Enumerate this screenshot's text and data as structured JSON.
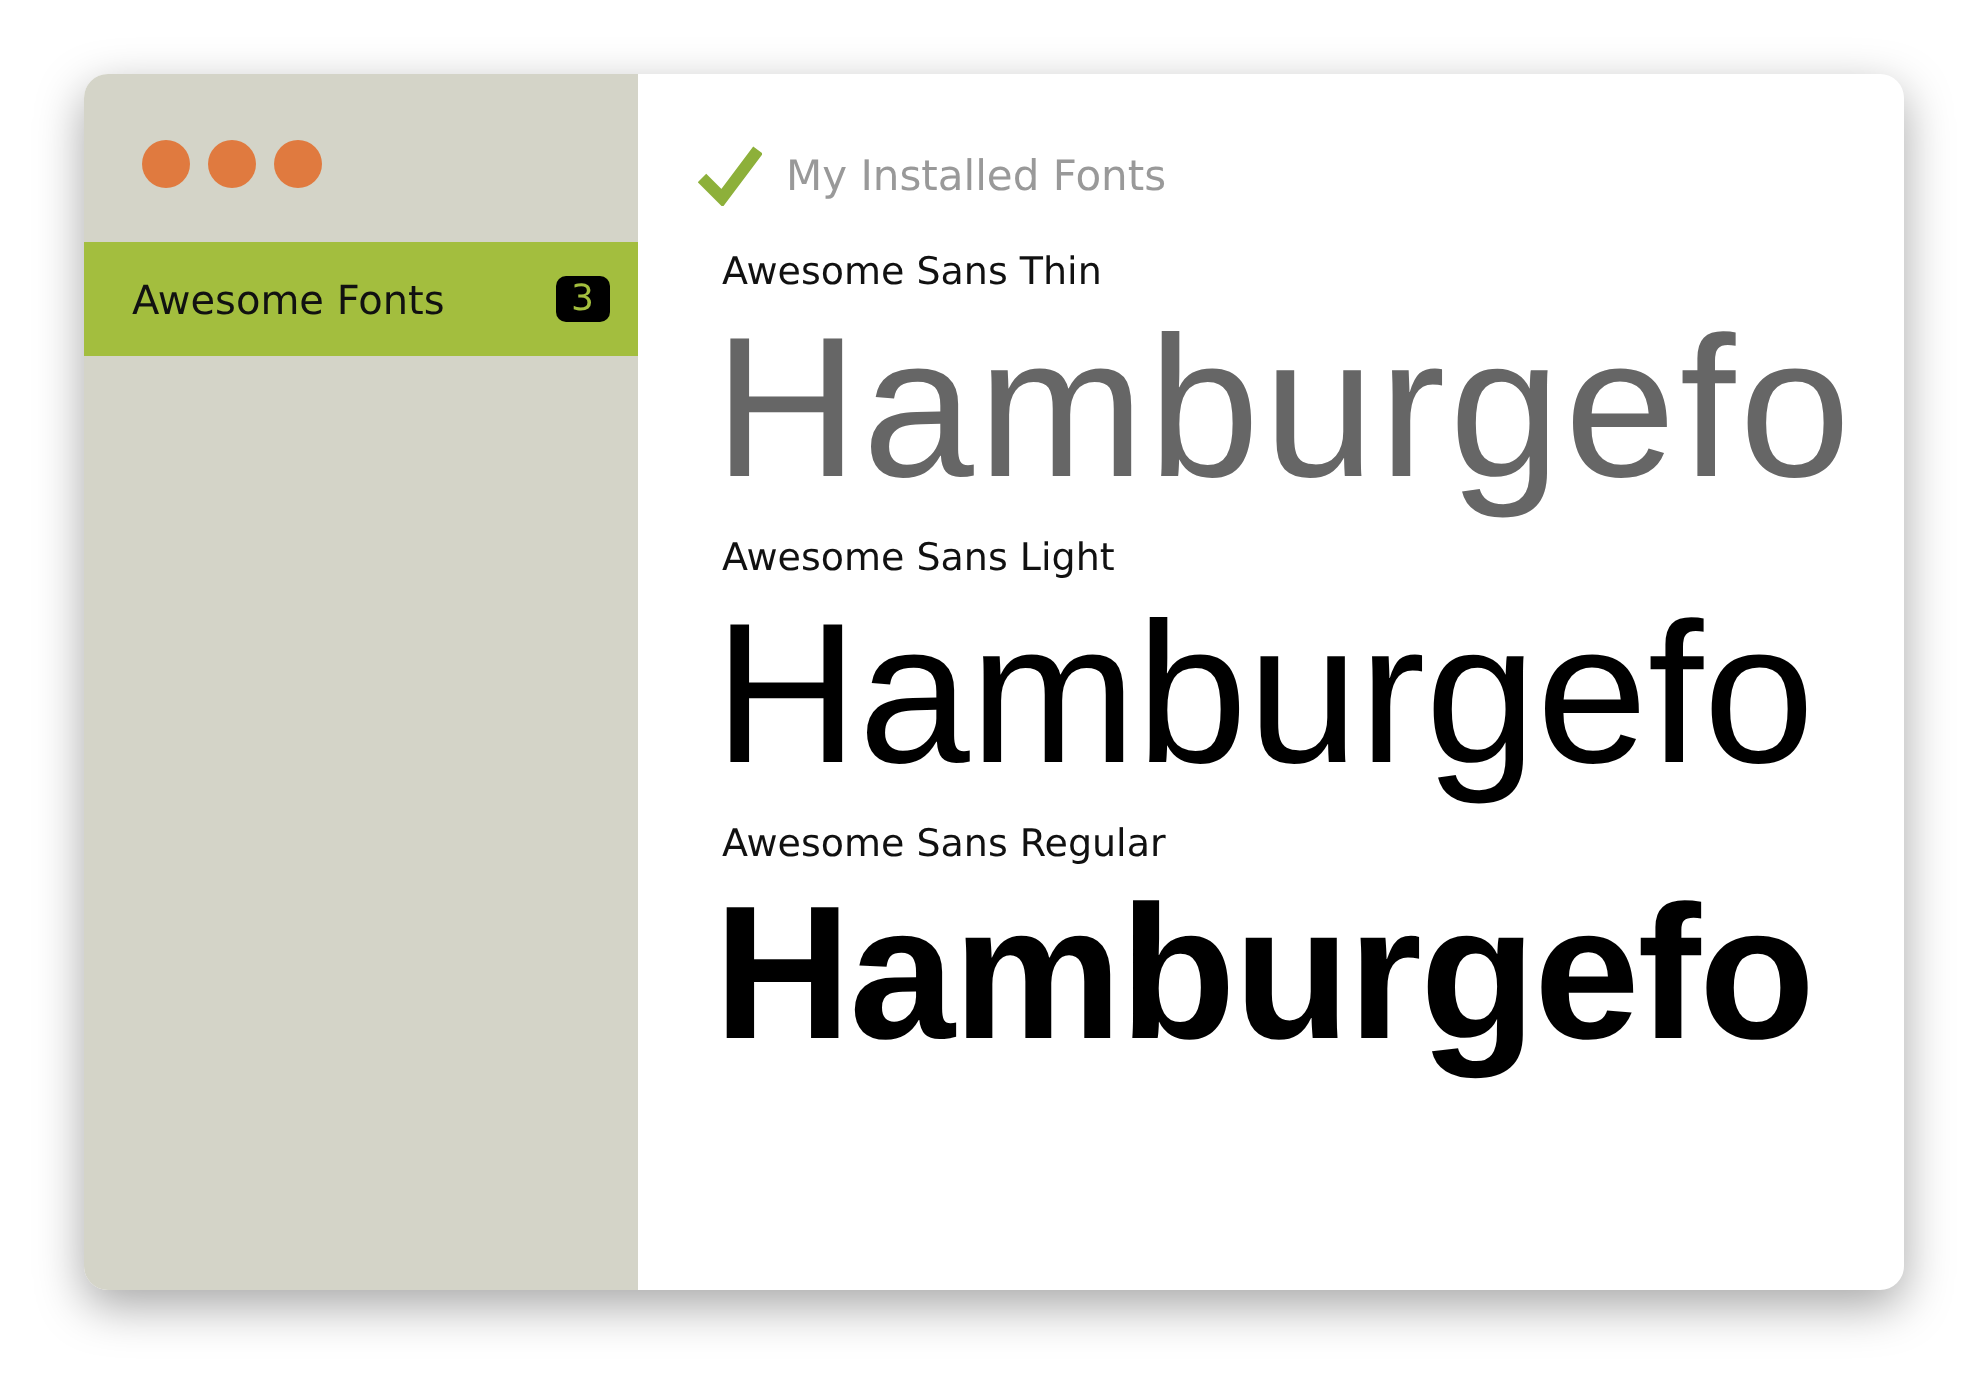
{
  "sidebar": {
    "items": [
      {
        "label": "Awesome Fonts",
        "count": "3",
        "selected": true
      }
    ]
  },
  "main": {
    "title": "My Installed Fonts",
    "fonts": [
      {
        "name": "Awesome Sans Thin",
        "sample": "Hamburgefo",
        "kind": "thin"
      },
      {
        "name": "Awesome Sans Light",
        "sample": "Hamburgefo",
        "kind": "light"
      },
      {
        "name": "Awesome Sans Regular",
        "sample": "Hamburgefo",
        "kind": "regular"
      }
    ]
  }
}
